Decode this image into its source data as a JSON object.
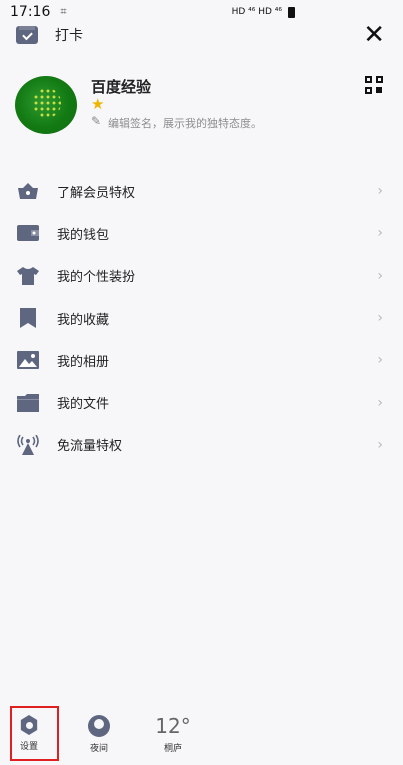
{
  "status_bar": {
    "time": "17:16",
    "indicators": "HD ⁴⁶ HD ⁴⁶"
  },
  "topbar": {
    "checkin_label": "打卡",
    "close_glyph": "✕"
  },
  "profile": {
    "username": "百度经验",
    "star_glyph": "★",
    "edit_glyph": "✎",
    "signature_placeholder": "编辑签名，展示我的独特态度。"
  },
  "menu": {
    "chevron": "›",
    "items": [
      {
        "label": "了解会员特权",
        "icon": "vip-shop-icon"
      },
      {
        "label": "我的钱包",
        "icon": "wallet-icon"
      },
      {
        "label": "我的个性装扮",
        "icon": "tshirt-icon"
      },
      {
        "label": "我的收藏",
        "icon": "bookmark-icon"
      },
      {
        "label": "我的相册",
        "icon": "photo-album-icon"
      },
      {
        "label": "我的文件",
        "icon": "folder-icon"
      },
      {
        "label": "免流量特权",
        "icon": "signal-tower-icon"
      }
    ]
  },
  "bottom": {
    "settings_label": "设置",
    "night_label": "夜间",
    "weather_temp": "12°",
    "weather_city": "桐庐"
  },
  "colors": {
    "icon": "#5f6680",
    "highlight": "#e02020",
    "avatar": "#137a13"
  }
}
